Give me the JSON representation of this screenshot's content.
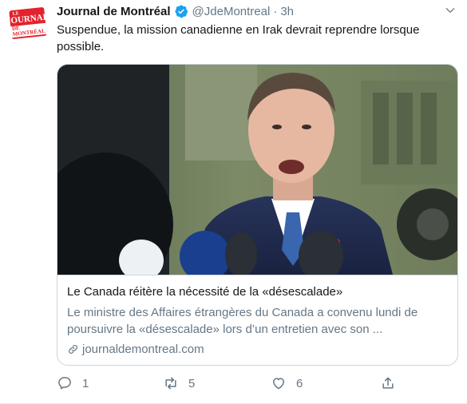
{
  "tweet": {
    "author_name": "Journal de Montréal",
    "handle": "@JdeMontreal",
    "separator": "·",
    "time": "3h",
    "text": "Suspendue, la mission canadienne en Irak devrait reprendre lorsque possible.",
    "avatar_logo": {
      "top": "LE",
      "main": "JOURNAL",
      "bottom": "DE MONTRÉAL"
    }
  },
  "card": {
    "title": "Le Canada réitère la nécessité de la «désescalade»",
    "description": "Le ministre des Affaires étrangères du Canada a convenu lundi de poursuivre la «désescalade» lors d’un entretien avec son ...",
    "domain": "journaldemontreal.com",
    "image_icon": "photo-of-man-speaking-to-microphones"
  },
  "actions": {
    "reply_count": "1",
    "retweet_count": "5",
    "like_count": "6"
  },
  "colors": {
    "text_primary": "#14171a",
    "text_secondary": "#657786",
    "verified_blue": "#1da1f2",
    "border": "#ccd6dd",
    "logo_red": "#e3222c"
  }
}
